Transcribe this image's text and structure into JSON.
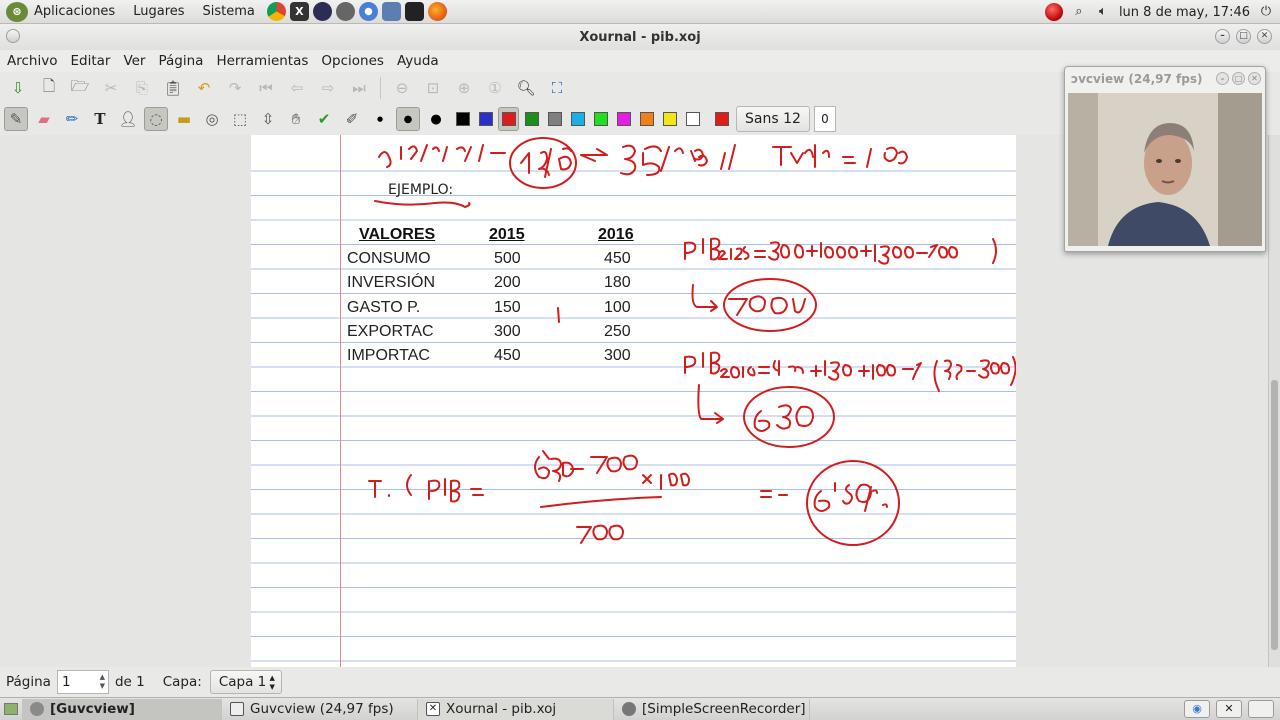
{
  "top_panel": {
    "menus": [
      "Aplicaciones",
      "Lugares",
      "Sistema"
    ],
    "launchers": [
      "chrome-icon",
      "terminal-icon",
      "eclipse-icon",
      "camera-icon",
      "chromium-icon",
      "network-icon",
      "screen-icon",
      "firefox-icon"
    ],
    "clock": "lun  8 de may, 17:46"
  },
  "window": {
    "title": "Xournal - pib.xoj"
  },
  "menubar": [
    "Archivo",
    "Editar",
    "Ver",
    "Página",
    "Herramientas",
    "Opciones",
    "Ayuda"
  ],
  "toolbar2": {
    "font_label": "Sans 12",
    "font_size_box": "0",
    "colors": [
      "#000000",
      "#2d2dc8",
      "#e01b1b",
      "#1a8f1a",
      "#7f7f7f",
      "#19b0e8",
      "#1fe01f",
      "#e01fe0",
      "#f08019",
      "#f0e619",
      "#ffffff",
      "#e01b1b"
    ],
    "active_color_index": 2
  },
  "document": {
    "ejemplo": "EJEMPLO:",
    "headers": [
      "VALORES",
      "2015",
      "2016"
    ],
    "rows": [
      [
        "CONSUMO",
        "500",
        "450"
      ],
      [
        "INVERSIÓN",
        "200",
        "180"
      ],
      [
        "GASTO P.",
        "150",
        "100"
      ],
      [
        "EXPORTAC",
        "300",
        "250"
      ],
      [
        "IMPORTAC",
        "450",
        "300"
      ]
    ]
  },
  "webcam": {
    "title": "ɔvcview  (24,97 fps)"
  },
  "statusbar": {
    "page_label": "Página",
    "page_value": "1",
    "of_label": "de 1",
    "layer_label": "Capa:",
    "layer_value": "Capa 1"
  },
  "taskbar": {
    "tasks": [
      "[Guvcview]",
      "Guvcview  (24,97 fps)",
      "Xournal - pib.xoj",
      "[SimpleScreenRecorder]"
    ]
  }
}
